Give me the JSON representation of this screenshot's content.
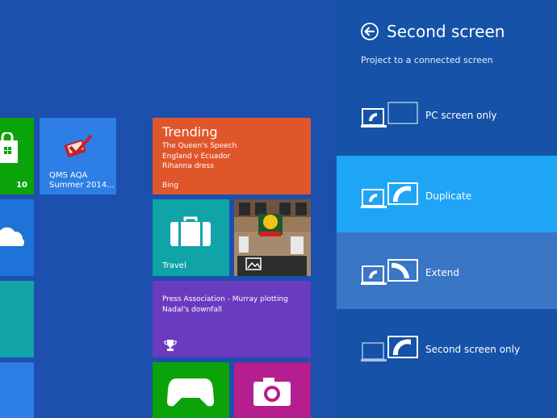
{
  "tiles": {
    "store": {
      "count": "10",
      "icon": "store-bag-icon"
    },
    "qms": {
      "label_line1": "QMS AQA",
      "label_line2": "Summer 2014...",
      "icon": "qms-tick-icon"
    },
    "trending": {
      "title": "Trending",
      "items": [
        "The Queen's Speech",
        "England v Ecuador",
        "Rihanna dress"
      ],
      "source": "Bing"
    },
    "travel": {
      "label": "Travel",
      "icon": "suitcase-icon"
    },
    "news": {
      "text": "Press Association - Murray plotting Nadal's downfall",
      "icon": "trophy-icon"
    },
    "xbox": {
      "icon": "xbox-controller-icon"
    },
    "camera": {
      "icon": "camera-icon"
    }
  },
  "charm": {
    "title": "Second screen",
    "subtitle": "Project to a connected screen",
    "options": [
      {
        "label": "PC screen only",
        "selected": false
      },
      {
        "label": "Duplicate",
        "selected": true
      },
      {
        "label": "Extend",
        "selected": false
      },
      {
        "label": "Second screen only",
        "selected": false
      }
    ]
  },
  "colors": {
    "start_bg": "#1c4fae",
    "charm_bg": "#1552a8",
    "selected": "#1fa5f5",
    "hover": "#3a76c6"
  }
}
